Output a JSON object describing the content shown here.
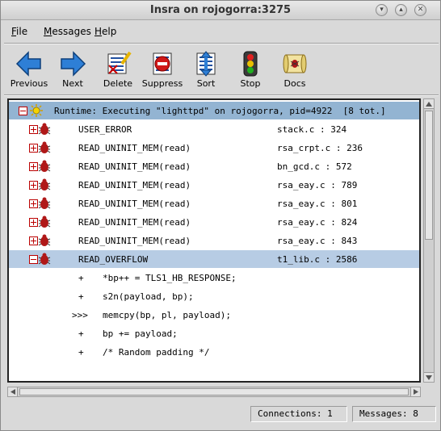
{
  "window": {
    "title": "Insra on rojogorra:3275",
    "controls": [
      "minimize-icon",
      "maximize-icon",
      "close-icon"
    ]
  },
  "menu": {
    "file": "File",
    "messages": "Messages",
    "help": "Help"
  },
  "toolbar": {
    "previous": "Previous",
    "next": "Next",
    "delete": "Delete",
    "suppress": "Suppress",
    "sort": "Sort",
    "stop": "Stop",
    "docs": "Docs"
  },
  "tree": {
    "header": "Runtime: Executing \"lighttpd\" on rojogorra, pid=4922  [8 tot.]",
    "items": [
      {
        "name": "USER_ERROR",
        "location": "stack.c : 324",
        "expanded": false
      },
      {
        "name": "READ_UNINIT_MEM(read)",
        "location": "rsa_crpt.c : 236",
        "expanded": false
      },
      {
        "name": "READ_UNINIT_MEM(read)",
        "location": "bn_gcd.c : 572",
        "expanded": false
      },
      {
        "name": "READ_UNINIT_MEM(read)",
        "location": "rsa_eay.c : 789",
        "expanded": false
      },
      {
        "name": "READ_UNINIT_MEM(read)",
        "location": "rsa_eay.c : 801",
        "expanded": false
      },
      {
        "name": "READ_UNINIT_MEM(read)",
        "location": "rsa_eay.c : 824",
        "expanded": false
      },
      {
        "name": "READ_UNINIT_MEM(read)",
        "location": "rsa_eay.c : 843",
        "expanded": false
      },
      {
        "name": "READ_OVERFLOW",
        "location": "t1_lib.c : 2586",
        "expanded": true,
        "selected": true
      }
    ],
    "code_lines": [
      {
        "marker": "+",
        "code": "*bp++ = TLS1_HB_RESPONSE;"
      },
      {
        "marker": "+",
        "code": "s2n(payload, bp);"
      },
      {
        "marker": ">>>",
        "code": "memcpy(bp, pl, payload);"
      },
      {
        "marker": "+",
        "code": "bp += payload;"
      },
      {
        "marker": "+",
        "code": "/* Random padding */"
      }
    ]
  },
  "status": {
    "connections": "Connections: 1",
    "messages": "Messages: 8"
  },
  "colors": {
    "header_row": "#93b4d2",
    "selected_row": "#b7cce4",
    "arrow_blue": "#2e7fd6"
  }
}
